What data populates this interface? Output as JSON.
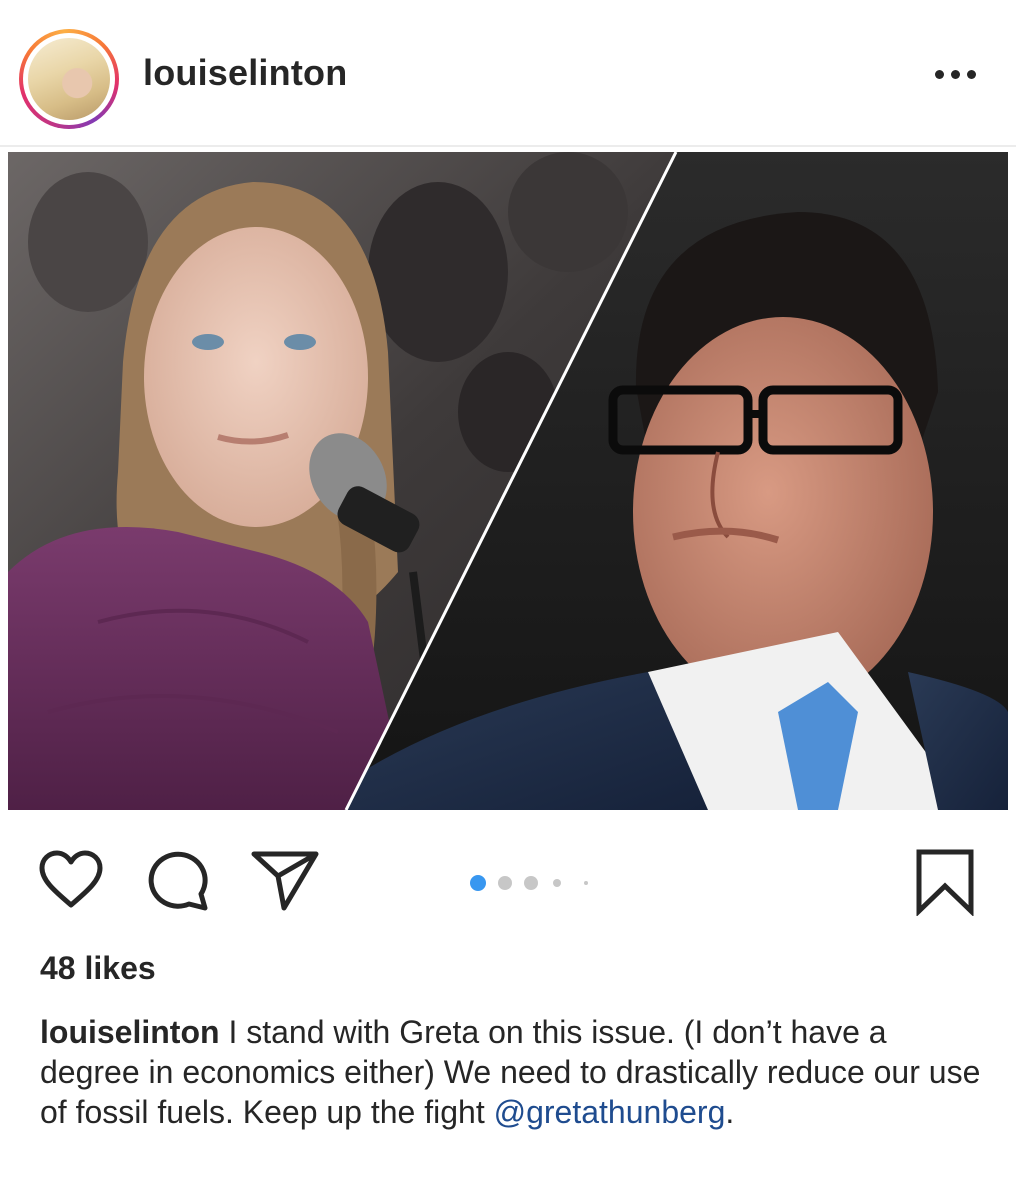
{
  "post": {
    "username": "louiselinton",
    "likes_text": "48 likes",
    "caption_username": "louiselinton",
    "caption_text": " I stand with Greta on this issue. (I don’t have a degree in economics either) We need to drastically reduce our use of fossil fuels. Keep up the fight ",
    "caption_mention": "@gretathunberg",
    "caption_end": "."
  },
  "carousel": {
    "count": 5,
    "active_index": 0,
    "active_color": "#3897f0"
  },
  "icons": {
    "more": "more-horizontal-icon",
    "like": "heart-icon",
    "comment": "comment-icon",
    "share": "paper-plane-icon",
    "save": "bookmark-icon"
  },
  "colors": {
    "text": "#262626",
    "mention": "#1f4c8f",
    "divider": "#ececec"
  }
}
